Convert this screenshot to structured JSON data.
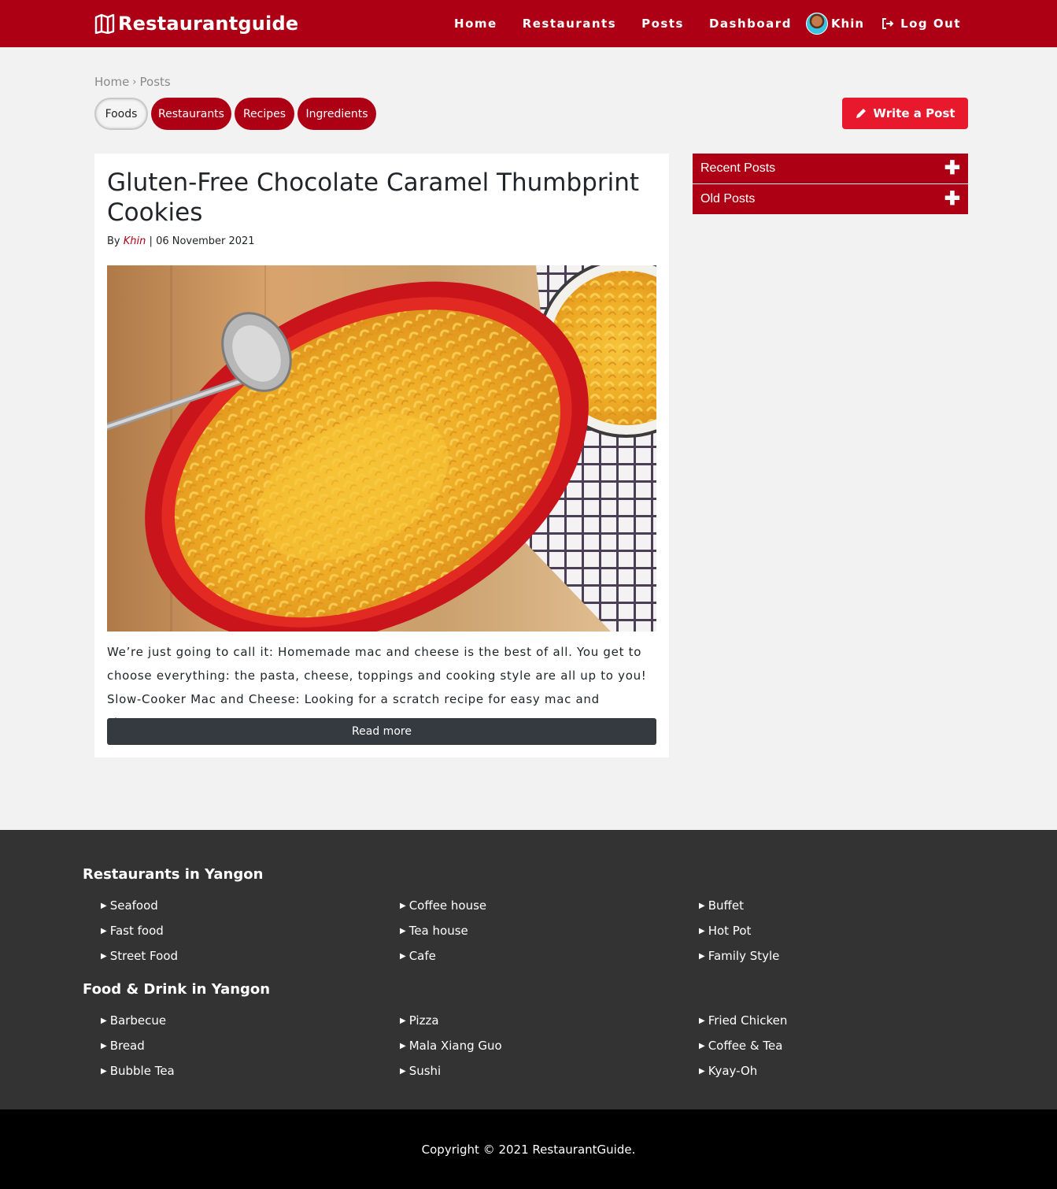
{
  "navbar": {
    "brand": "Restaurantguide",
    "links": [
      "Home",
      "Restaurants",
      "Posts",
      "Dashboard"
    ],
    "user_name": "Khin",
    "logout_label": "Log Out"
  },
  "breadcrumb": {
    "home": "Home",
    "current": "Posts"
  },
  "categories": [
    "Foods",
    "Restaurants",
    "Recipes",
    "Ingredients"
  ],
  "write_post_label": "Write a Post",
  "post": {
    "title": "Gluten-Free Chocolate Caramel Thumbprint Cookies",
    "by_label": "By",
    "author": "Khin",
    "date": "06 November 2021",
    "excerpt": "We’re just going to call it: Homemade mac and cheese is the best of all. You get to choose everything: the pasta, cheese, toppings and cooking style are all up to you! Slow-Cooker Mac and Cheese: Looking for a scratch recipe for easy mac and cheese?...",
    "read_more_label": "Read more"
  },
  "sidebar": {
    "recent_posts": "Recent Posts",
    "old_posts": "Old Posts"
  },
  "footer": {
    "restaurants_heading": "Restaurants in Yangon",
    "restaurants": [
      "Seafood",
      "Coffee house",
      "Buffet",
      "Fast food",
      "Tea house",
      "Hot Pot",
      "Street Food",
      "Cafe",
      "Family Style"
    ],
    "food_heading": "Food & Drink in Yangon",
    "food": [
      "Barbecue",
      "Pizza",
      "Fried Chicken",
      "Bread",
      "Mala Xiang Guo",
      "Coffee & Tea",
      "Bubble Tea",
      "Sushi",
      "Kyay-Oh"
    ],
    "copyright": "Copyright © 2021 RestaurantGuide."
  },
  "colors": {
    "brand_red": "#ad0015",
    "write_button": "#e8192c",
    "read_more": "#343a40",
    "footer": "#333333"
  }
}
